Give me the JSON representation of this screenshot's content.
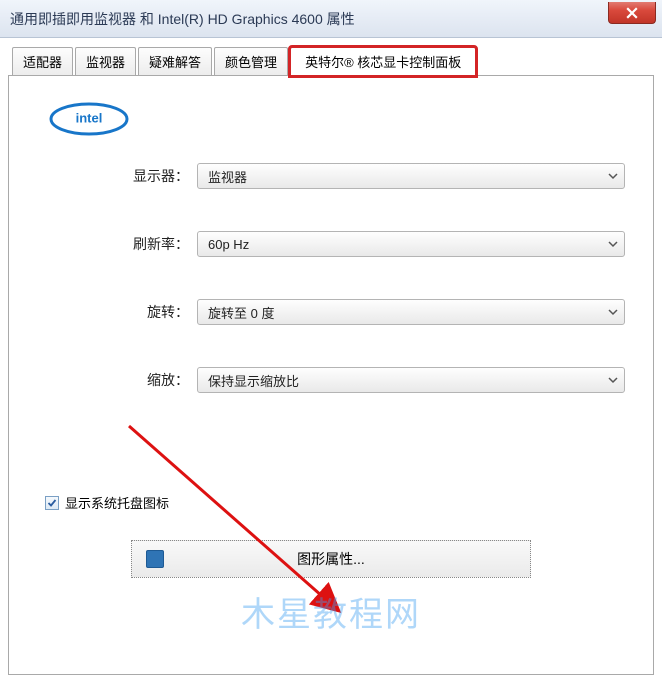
{
  "window": {
    "title": "通用即插即用监视器 和 Intel(R) HD Graphics 4600 属性"
  },
  "tabs": [
    {
      "label": "适配器"
    },
    {
      "label": "监视器"
    },
    {
      "label": "疑难解答"
    },
    {
      "label": "颜色管理"
    },
    {
      "label": "英特尔® 核芯显卡控制面板"
    }
  ],
  "form": {
    "display_label": "显示器：",
    "display_value": "监视器",
    "refresh_label": "刷新率：",
    "refresh_value": "60p Hz",
    "rotation_label": "旋转：",
    "rotation_value": "旋转至 0 度",
    "scaling_label": "缩放：",
    "scaling_value": "保持显示缩放比"
  },
  "checkbox": {
    "label": "显示系统托盘图标",
    "checked": true
  },
  "button": {
    "label": "图形属性..."
  },
  "watermark": "木星教程网"
}
